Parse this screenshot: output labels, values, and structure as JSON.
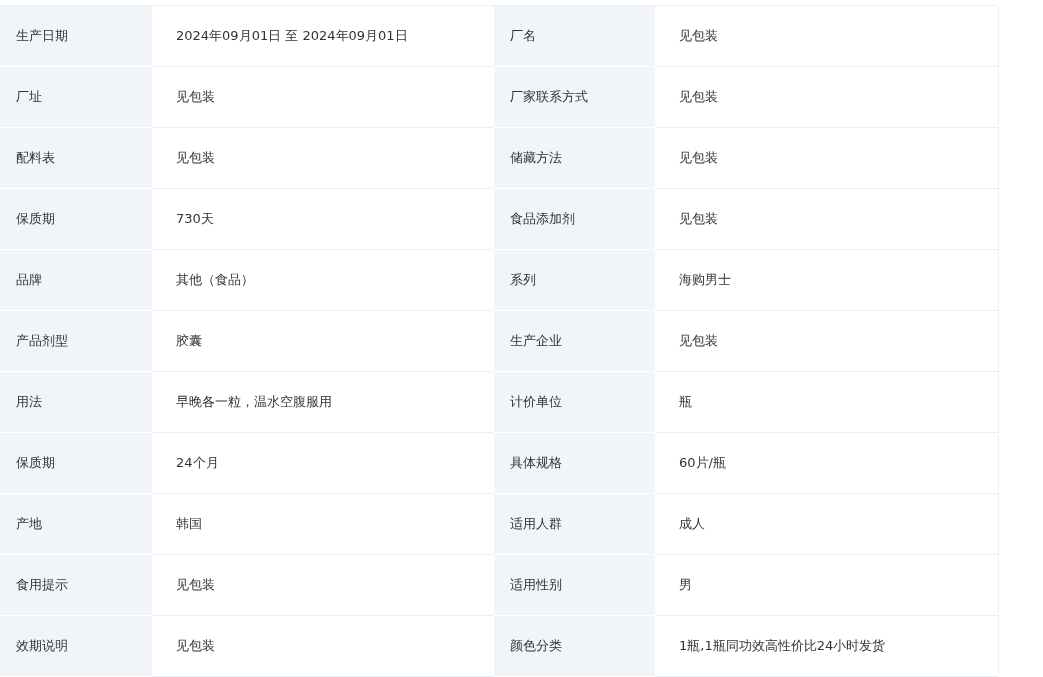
{
  "rows": [
    [
      {
        "label": "生产日期",
        "value": "2024年09月01日 至 2024年09月01日"
      },
      {
        "label": "厂名",
        "value": "见包装"
      }
    ],
    [
      {
        "label": "厂址",
        "value": "见包装"
      },
      {
        "label": "厂家联系方式",
        "value": "见包装"
      }
    ],
    [
      {
        "label": "配料表",
        "value": "见包装"
      },
      {
        "label": "储藏方法",
        "value": "见包装"
      }
    ],
    [
      {
        "label": "保质期",
        "value": "730天"
      },
      {
        "label": "食品添加剂",
        "value": "见包装"
      }
    ],
    [
      {
        "label": "品牌",
        "value": "其他（食品）"
      },
      {
        "label": "系列",
        "value": "海购男士"
      }
    ],
    [
      {
        "label": "产品剂型",
        "value": "胶囊"
      },
      {
        "label": "生产企业",
        "value": "见包装"
      }
    ],
    [
      {
        "label": "用法",
        "value": "早晚各一粒，温水空腹服用"
      },
      {
        "label": "计价单位",
        "value": "瓶"
      }
    ],
    [
      {
        "label": "保质期",
        "value": "24个月"
      },
      {
        "label": "具体规格",
        "value": "60片/瓶"
      }
    ],
    [
      {
        "label": "产地",
        "value": "韩国"
      },
      {
        "label": "适用人群",
        "value": "成人"
      }
    ],
    [
      {
        "label": "食用提示",
        "value": "见包装"
      },
      {
        "label": "适用性别",
        "value": "男"
      }
    ],
    [
      {
        "label": "效期说明",
        "value": "见包装"
      },
      {
        "label": "颜色分类",
        "value": "1瓶,1瓶同功效高性价比24小时发货"
      }
    ]
  ]
}
